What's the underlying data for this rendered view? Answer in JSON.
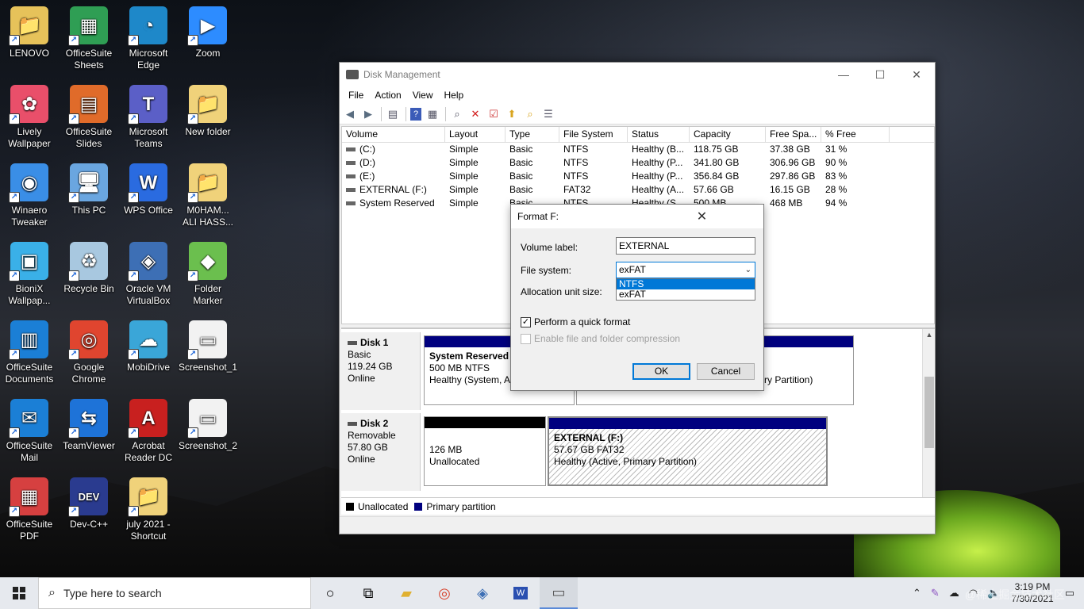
{
  "desktop_icons": [
    {
      "label": "LENOVO",
      "color": "#e6c25a",
      "glyph": "📁"
    },
    {
      "label": "OfficeSuite Sheets",
      "color": "#2f9e54",
      "glyph": "▦"
    },
    {
      "label": "Microsoft Edge",
      "color": "#1e88c9",
      "glyph": "◔"
    },
    {
      "label": "Zoom",
      "color": "#2d8cff",
      "glyph": "▶"
    },
    {
      "label": "Lively Wallpaper",
      "color": "#e94f6a",
      "glyph": "✿"
    },
    {
      "label": "OfficeSuite Slides",
      "color": "#e06b2a",
      "glyph": "▤"
    },
    {
      "label": "Microsoft Teams",
      "color": "#5b5fc7",
      "glyph": "T"
    },
    {
      "label": "New folder",
      "color": "#f0d27a",
      "glyph": "📁"
    },
    {
      "label": "Winaero Tweaker",
      "color": "#3a8ee6",
      "glyph": "◉"
    },
    {
      "label": "This PC",
      "color": "#6aa6e0",
      "glyph": "🖥"
    },
    {
      "label": "WPS Office",
      "color": "#2a6be0",
      "glyph": "W"
    },
    {
      "label": "M0HAM... ALI HASS...",
      "color": "#f0d27a",
      "glyph": "📁"
    },
    {
      "label": "BioniX Wallpap...",
      "color": "#3ab0e8",
      "glyph": "▣"
    },
    {
      "label": "Recycle Bin",
      "color": "#a8c8e0",
      "glyph": "♻"
    },
    {
      "label": "Oracle VM VirtualBox",
      "color": "#3d6fb5",
      "glyph": "◈"
    },
    {
      "label": "Folder Marker",
      "color": "#6bbf4e",
      "glyph": "◆"
    },
    {
      "label": "OfficeSuite Documents",
      "color": "#1b7fd6",
      "glyph": "▥"
    },
    {
      "label": "Google Chrome",
      "color": "#e0452f",
      "glyph": "◎"
    },
    {
      "label": "MobiDrive",
      "color": "#3aa6d8",
      "glyph": "☁"
    },
    {
      "label": "Screenshot_1",
      "color": "#f2f2f2",
      "glyph": "▭"
    },
    {
      "label": "OfficeSuite Mail",
      "color": "#1b7fd6",
      "glyph": "✉"
    },
    {
      "label": "TeamViewer",
      "color": "#1e73d8",
      "glyph": "⇆"
    },
    {
      "label": "Acrobat Reader DC",
      "color": "#c8201f",
      "glyph": "A"
    },
    {
      "label": "Screenshot_2",
      "color": "#f2f2f2",
      "glyph": "▭"
    },
    {
      "label": "OfficeSuite PDF",
      "color": "#d64040",
      "glyph": "▦"
    },
    {
      "label": "Dev-C++",
      "color": "#2a3b8f",
      "glyph": "DEV"
    },
    {
      "label": "july 2021 - Shortcut",
      "color": "#f0d27a",
      "glyph": "📁"
    }
  ],
  "window": {
    "title": "Disk Management",
    "menu": [
      "File",
      "Action",
      "View",
      "Help"
    ],
    "minimize": "—",
    "maximize": "☐",
    "close": "✕"
  },
  "volume_table": {
    "columns": [
      "Volume",
      "Layout",
      "Type",
      "File System",
      "Status",
      "Capacity",
      "Free Spa...",
      "% Free"
    ],
    "rows": [
      [
        "(C:)",
        "Simple",
        "Basic",
        "NTFS",
        "Healthy (B...",
        "118.75 GB",
        "37.38 GB",
        "31 %"
      ],
      [
        "(D:)",
        "Simple",
        "Basic",
        "NTFS",
        "Healthy (P...",
        "341.80 GB",
        "306.96 GB",
        "90 %"
      ],
      [
        "(E:)",
        "Simple",
        "Basic",
        "NTFS",
        "Healthy (P...",
        "356.84 GB",
        "297.86 GB",
        "83 %"
      ],
      [
        "EXTERNAL (F:)",
        "Simple",
        "Basic",
        "FAT32",
        "Healthy (A...",
        "57.66 GB",
        "16.15 GB",
        "28 %"
      ],
      [
        "System Reserved",
        "Simple",
        "Basic",
        "NTFS",
        "Healthy (S...",
        "500 MB",
        "468 MB",
        "94 %"
      ]
    ]
  },
  "disks": [
    {
      "name": "Disk 1",
      "type": "Basic",
      "size": "119.24 GB",
      "status": "Online",
      "partitions": [
        {
          "name": "System Reserved",
          "detail": "500 MB NTFS",
          "state": "Healthy (System, Ac"
        },
        {
          "name": "",
          "detail": "",
          "state": "ry Partition)"
        }
      ]
    },
    {
      "name": "Disk 2",
      "type": "Removable",
      "size": "57.80 GB",
      "status": "Online",
      "partitions": [
        {
          "name": "",
          "detail": "126 MB",
          "state": "Unallocated"
        },
        {
          "name": "EXTERNAL  (F:)",
          "detail": "57.67 GB FAT32",
          "state": "Healthy (Active, Primary Partition)"
        }
      ]
    }
  ],
  "legend": {
    "unallocated": "Unallocated",
    "primary": "Primary partition"
  },
  "colors": {
    "primary": "#00007f",
    "unallocated": "#000000",
    "accent": "#0078d7"
  },
  "format_dialog": {
    "title": "Format F:",
    "volume_label_caption": "Volume label:",
    "volume_label_value": "EXTERNAL",
    "file_system_caption": "File system:",
    "file_system_value": "exFAT",
    "file_system_options": [
      "NTFS",
      "exFAT"
    ],
    "allocation_caption": "Allocation unit size:",
    "quick_format": "Perform a quick format",
    "compression": "Enable file and folder compression",
    "ok": "OK",
    "cancel": "Cancel"
  },
  "taskbar": {
    "search_placeholder": "Type here to search",
    "time": "3:19 PM",
    "date": "7/30/2021",
    "watermark": "@稀土掘金技术社区"
  }
}
